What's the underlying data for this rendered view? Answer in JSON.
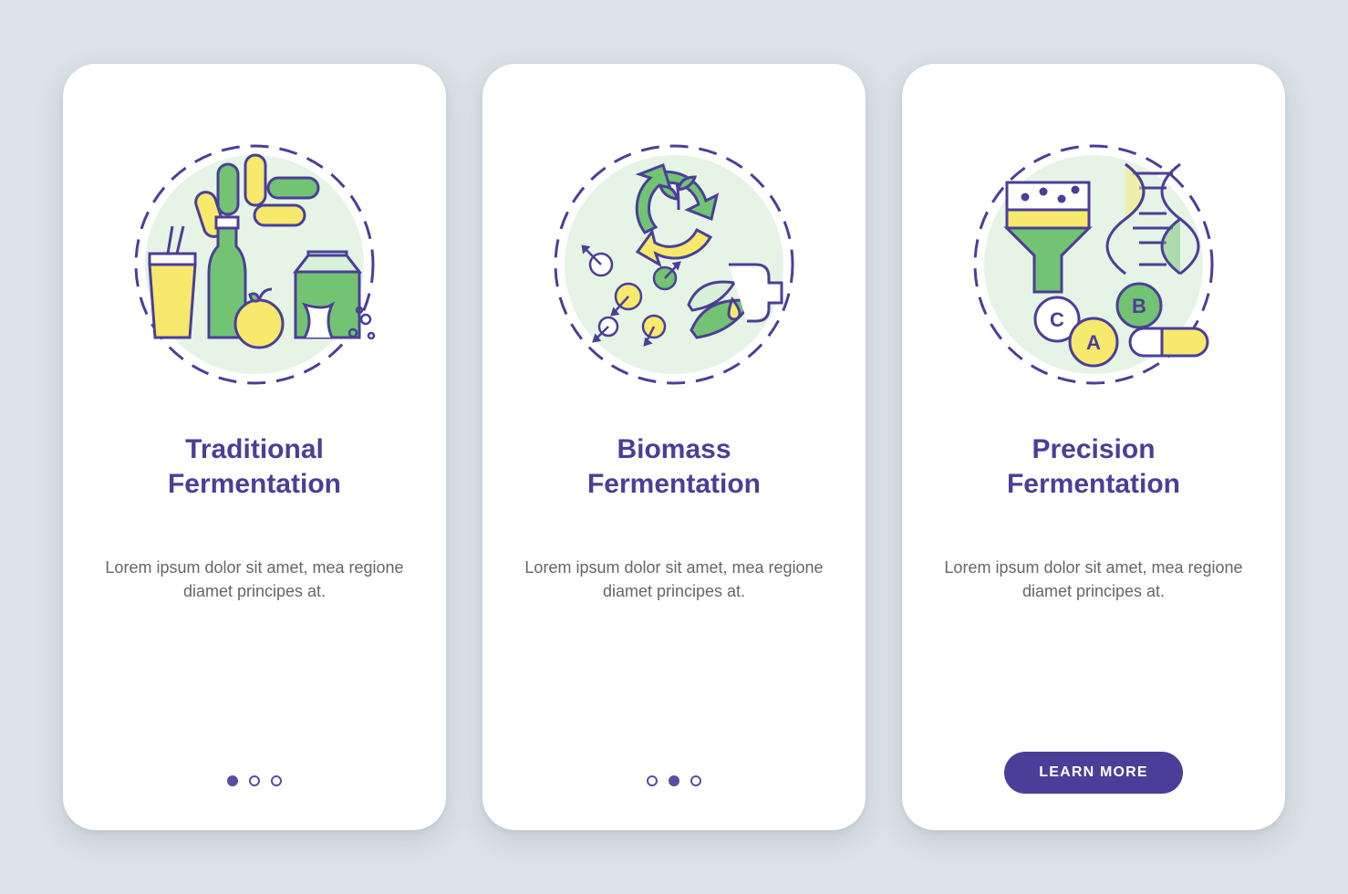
{
  "screens": [
    {
      "title": "Traditional\nFermentation",
      "body": "Lorem ipsum dolor sit amet, mea regione diamet principes at.",
      "icon_name": "traditional-fermentation-icon",
      "pagination": {
        "total": 3,
        "active": 0
      },
      "cta": null
    },
    {
      "title": "Biomass\nFermentation",
      "body": "Lorem ipsum dolor sit amet, mea regione diamet principes at.",
      "icon_name": "biomass-fermentation-icon",
      "pagination": {
        "total": 3,
        "active": 1
      },
      "cta": null
    },
    {
      "title": "Precision\nFermentation",
      "body": "Lorem ipsum dolor sit amet, mea regione diamet principes at.",
      "icon_name": "precision-fermentation-icon",
      "pagination": null,
      "cta": "LEARN MORE"
    }
  ],
  "colors": {
    "accent": "#4b3e99",
    "green": "#72c472",
    "green_light": "#d9f0d9",
    "yellow": "#f6e96b",
    "stroke": "#4b3e99",
    "bg": "#dbe3e8"
  }
}
